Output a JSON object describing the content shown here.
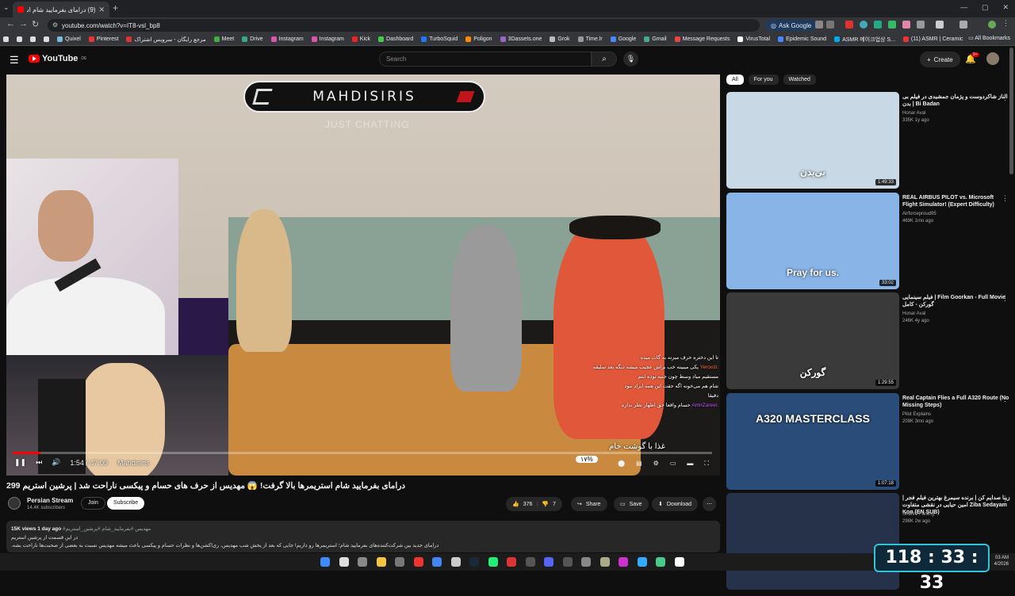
{
  "browser": {
    "tab_title": "(9) درامای بفرمایید شام استریمرها بالا گرفت...",
    "url": "youtube.com/watch?v=IT8-vsl_bp8",
    "ask_google": "Ask Google",
    "all_bookmarks": "All Bookmarks",
    "bookmarks": [
      "Quixel",
      "Pinterest",
      "مرجع رایگان - سرویس اشتراک",
      "Meet",
      "Drive",
      "Instagram",
      "Instagram",
      "Kick",
      "Dashboard",
      "TurboSquid",
      "Poligon",
      "3Dassets.one",
      "Grok",
      "Time.lr",
      "Google",
      "Gmail",
      "Message Requests",
      "VirusTotal",
      "Epidemic Sound",
      "ASMR 메이크업상 S...",
      "(11) ASMR | Ceramic..."
    ]
  },
  "youtube": {
    "logo": "YouTube",
    "region": "DE",
    "search_placeholder": "Search",
    "create_label": "Create",
    "notif_count": "9+"
  },
  "player": {
    "banner_text": "MAHDISIRIS",
    "banner_sub": "JUST CHATTING",
    "time": "1:54 / 47:09",
    "chapter": "Mahdisiris",
    "progress": 0.04,
    "chat": [
      {
        "name": "",
        "text": "تا این دختره حرف میزنه به گات میده"
      },
      {
        "name": "Yeroozi:",
        "text": "یکی میبینه خب براش عجیب میشه دیگه بعد سلیقه"
      },
      {
        "name": "",
        "text": "مستقیم میاد وسط چون جنبه بوده ایتم"
      },
      {
        "name": "",
        "text": "شام هم می‌خونه اگه حقت این همه ایراد نبود"
      },
      {
        "name": "",
        "text": "دقیقا"
      },
      {
        "name": "AmirZareei:",
        "text": "حسام واقعا حق اظهار نظر نداره"
      }
    ],
    "food_caption": "غذا با گوشت خام",
    "percent_badge": "۱۷%"
  },
  "video": {
    "title": "درامای بفرمایید شام استریمرها بالا گرفت! 😱 مهدیس از حرف های حسام و پیکسی ناراحت شد | پرشین استریم 299",
    "channel": "Persian Stream",
    "subs": "14.4K subscribers",
    "join": "Join",
    "subscribe": "Subscribe",
    "likes": "376",
    "dislikes": "7",
    "share": "Share",
    "save": "Save",
    "download": "Download",
    "views_date": "15K views  1 day ago",
    "hashtags": "#مهدیس #بفرمایید_شام #پرشین_استریم",
    "desc_line1": "در این قسمت از پرشین استریم",
    "desc_line2": "درامای جدید بین شرکت‌کننده‌های بفرمایید شام؛ استریمرها رو داریم! جایی که بعد از پخش شب مهدیس، ری‌اکشن‌ها و نظرات حسام و پیکسی باعث میشه مهدیس نسبت به بعضی از صحبت‌ها ناراحت بشه."
  },
  "chips": [
    "All",
    "For you",
    "Watched"
  ],
  "recommendations": [
    {
      "title": "الناز شاکردوست و پژمان جمشیدی در فیلم بی بدن | Bi Badan",
      "channel": "Honar Aval",
      "meta": "335K  1y ago",
      "duration": "1:49:33",
      "thumb_text": "بی‌بدن",
      "color": "#c8d8e4"
    },
    {
      "title": "REAL AIRBUS PILOT vs. Microsoft Flight Simulator! (Expert Difficulty)",
      "channel": "Airforceproud95",
      "meta": "469K  1mo ago",
      "duration": "33:02",
      "thumb_text": "Pray for us.",
      "color": "#88b4e8"
    },
    {
      "title": "فیلم سینمایی | Film Goorkan - Full Movie گورکن - کامل",
      "channel": "Honar Aval",
      "meta": "246K  4y ago",
      "duration": "1:29:55",
      "thumb_text": "گورکن",
      "color": "#3a3a3a"
    },
    {
      "title": "Real Captain Flies a Full A320 Route (No Missing Steps)",
      "channel": "Pilot Explains",
      "meta": "209K  3mo ago",
      "duration": "1:07:18",
      "thumb_text": "A320 MASTERCLASS",
      "color": "#2a4c78"
    },
    {
      "title": "زیبا صدایم کن | برنده سیمرغ بهترین فیلم فجر | امین حیایی در نقشی متفاوت Ziba Sedayam Kon (EN SUB)",
      "channel": "Shahre Farang",
      "meta": "298K  2w ago",
      "duration": "",
      "thumb_text": "",
      "color": "#25324a"
    }
  ],
  "clock_widget": "118 : 33 : 33",
  "systray": {
    "time": "03 AM",
    "date": "4/2026"
  },
  "colors": {
    "accent": "#ff0000",
    "bg": "#0f0f0f",
    "chip": "#272727"
  }
}
